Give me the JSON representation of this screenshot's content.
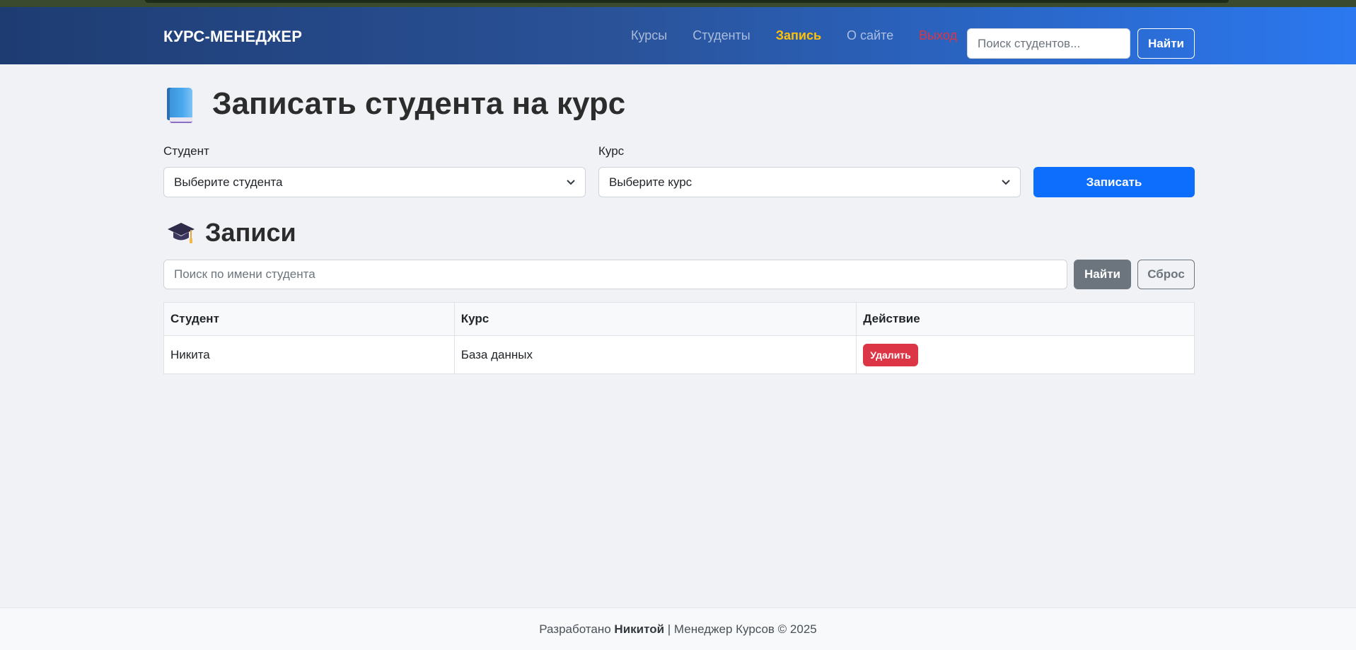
{
  "navbar": {
    "brand": "КУРС-МЕНЕДЖЕР",
    "links": [
      {
        "label": "Курсы"
      },
      {
        "label": "Студенты"
      },
      {
        "label": "Запись"
      },
      {
        "label": "О сайте"
      },
      {
        "label": "Выход"
      }
    ],
    "search_placeholder": "Поиск студентов...",
    "search_button": "Найти"
  },
  "enroll": {
    "title": "Записать студента на курс",
    "icon": "book-icon",
    "student_label": "Студент",
    "student_value": "Выберите студента",
    "course_label": "Курс",
    "course_value": "Выберите курс",
    "submit": "Записать"
  },
  "records": {
    "title": "Записи",
    "icon": "graduation-cap-icon",
    "search_placeholder": "Поиск по имени студента",
    "find_button": "Найти",
    "reset_button": "Сброс",
    "columns": [
      "Студент",
      "Курс",
      "Действие"
    ],
    "rows": [
      {
        "student": "Никита",
        "course": "База данных",
        "action": "Удалить"
      }
    ]
  },
  "footer": {
    "prefix": "Разработано",
    "author": "Никитой",
    "suffix": "| Менеджер Курсов © 2025"
  },
  "colors": {
    "primary": "#0d6efd",
    "danger": "#dc3545",
    "warning": "#ffc107",
    "secondary": "#6c757d"
  }
}
